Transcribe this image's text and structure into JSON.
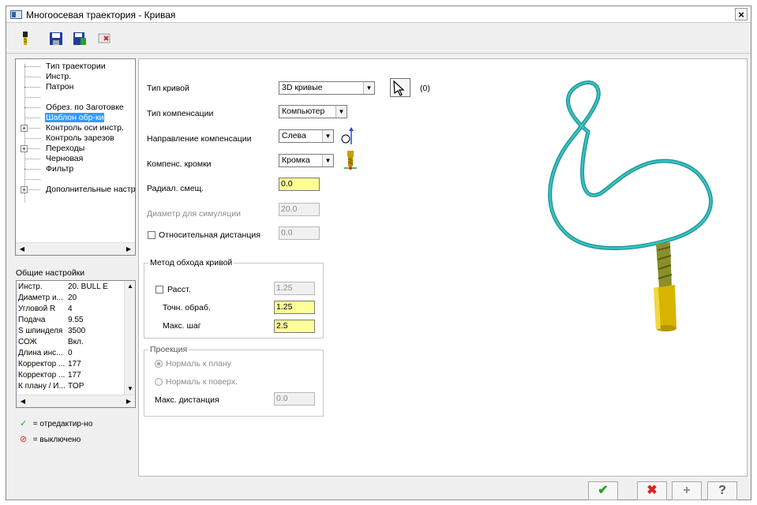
{
  "window": {
    "title": "Многоосевая траектория - Кривая",
    "close": "×"
  },
  "toolbar": {
    "icons": [
      "tool-icon",
      "save-icon",
      "save-as-icon",
      "delete-icon"
    ]
  },
  "tree": {
    "items": [
      {
        "label": "Тип траектории",
        "expandable": false,
        "selected": false
      },
      {
        "label": "Инстр.",
        "expandable": false,
        "selected": false
      },
      {
        "label": "Патрон",
        "expandable": false,
        "selected": false
      },
      {
        "label": "",
        "expandable": false,
        "selected": false
      },
      {
        "label": "Обрез. по Заготовке",
        "expandable": false,
        "selected": false
      },
      {
        "label": "Шаблон обр-ки",
        "expandable": false,
        "selected": true
      },
      {
        "label": "Контроль оси инстр.",
        "expandable": true,
        "selected": false
      },
      {
        "label": "Контроль зарезов",
        "expandable": false,
        "selected": false
      },
      {
        "label": "Переходы",
        "expandable": true,
        "selected": false
      },
      {
        "label": "Черновая",
        "expandable": false,
        "selected": false
      },
      {
        "label": "Фильтр",
        "expandable": false,
        "selected": false
      },
      {
        "label": "",
        "expandable": false,
        "selected": false
      },
      {
        "label": "Дополнительные настройки",
        "expandable": true,
        "selected": false
      }
    ]
  },
  "general": {
    "title": "Общие настройки",
    "rows": [
      {
        "k": "Инстр.",
        "v": "20. BULL E"
      },
      {
        "k": "Диаметр и...",
        "v": "20"
      },
      {
        "k": "Угловой R",
        "v": "4"
      },
      {
        "k": "Подача",
        "v": "9.55"
      },
      {
        "k": "S шпинделя",
        "v": "3500"
      },
      {
        "k": "СОЖ",
        "v": "Вкл."
      },
      {
        "k": "Длина инс...",
        "v": "0"
      },
      {
        "k": "Корректор ...",
        "v": "177"
      },
      {
        "k": "Корректор ...",
        "v": "177"
      },
      {
        "k": "К плану / И...",
        "v": "TOP"
      }
    ]
  },
  "legend": {
    "edited_symbol": "✓",
    "edited": "= отредактир-но",
    "disabled_symbol": "⊘",
    "disabled": "= выключено"
  },
  "form": {
    "curve_type_label": "Тип кривой",
    "curve_type_value": "3D кривые",
    "curve_count": "(0)",
    "comp_type_label": "Тип компенсации",
    "comp_type_value": "Компьютер",
    "comp_dir_label": "Направление компенсации",
    "comp_dir_value": "Слева",
    "comp_tip_label": "Компенс. кромки",
    "comp_tip_value": "Кромка",
    "radial_offset_label": "Радиал. смещ.",
    "radial_offset_value": "0.0",
    "sim_diameter_label": "Диаметр для симуляции",
    "sim_diameter_value": "20.0",
    "relative_distance_label": "Относительная дистанция",
    "relative_distance_value": "0.0",
    "curve_method_title": "Метод обхода кривой",
    "distance_label": "Расст.",
    "distance_value": "1.25",
    "accuracy_label": "Точн. обраб.",
    "accuracy_value": "1.25",
    "max_step_label": "Макс. шаг",
    "max_step_value": "2.5",
    "projection_title": "Проекция",
    "normal_to_plane_label": "Нормаль к плану",
    "normal_to_surface_label": "Нормаль к поверх.",
    "max_distance_label": "Макс. дистанция",
    "max_distance_value": "0.0"
  },
  "buttons": {
    "ok_symbol": "✔",
    "cancel_symbol": "✖",
    "add_symbol": "+",
    "help_symbol": "?"
  },
  "colors": {
    "accent_selection": "#3399ff",
    "highlight_field": "#ffff99",
    "curve": "#2ab5b5",
    "tool": "#c8b000"
  }
}
